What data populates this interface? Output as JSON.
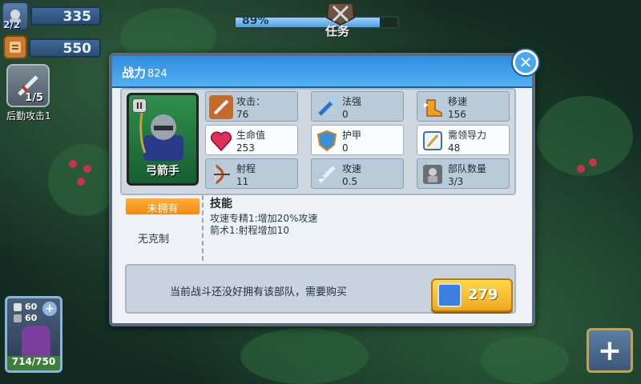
{
  "hud": {
    "player_count": "2/2",
    "energy": "335",
    "scroll": "550",
    "progress_text": "89%",
    "progress_fraction": 0.89,
    "mission_label": "任务"
  },
  "side": {
    "attack_count": "1/5",
    "attack_label": "后勤攻击1",
    "unit_stat1": "60",
    "unit_stat2": "60",
    "unit_hp": "714/750",
    "add_button": "+"
  },
  "dialog": {
    "title": "战力",
    "power": "824",
    "close": "✕",
    "unit_name": "弓箭手",
    "pause": "II",
    "stats": [
      {
        "label": "攻击：",
        "value": "76",
        "icon": "sword-icon"
      },
      {
        "label": "法强",
        "value": "0",
        "icon": "magic-wand-icon"
      },
      {
        "label": "移速",
        "value": "156",
        "icon": "winged-boot-icon"
      },
      {
        "label": "生命值",
        "value": "253",
        "icon": "heart-icon"
      },
      {
        "label": "护甲",
        "value": "0",
        "icon": "shield-icon"
      },
      {
        "label": "需领导力",
        "value": "48",
        "icon": "banner-icon"
      },
      {
        "label": "射程",
        "value": "11",
        "icon": "bow-icon"
      },
      {
        "label": "攻速",
        "value": "0.5",
        "icon": "fast-sword-icon"
      },
      {
        "label": "部队数量",
        "value": "3/3",
        "icon": "squad-icon"
      }
    ],
    "own_status": "未拥有",
    "counter": "无克制",
    "skill_title": "技能",
    "skills": [
      "攻速专精1:增加20%攻速",
      "箭术1:射程增加10"
    ],
    "buy_message": "当前战斗还没好拥有该部队，需要购买",
    "price": "279"
  },
  "colors": {
    "accent": "#4aa8f0",
    "gold": "#f0a820",
    "orange": "#f08a16"
  }
}
